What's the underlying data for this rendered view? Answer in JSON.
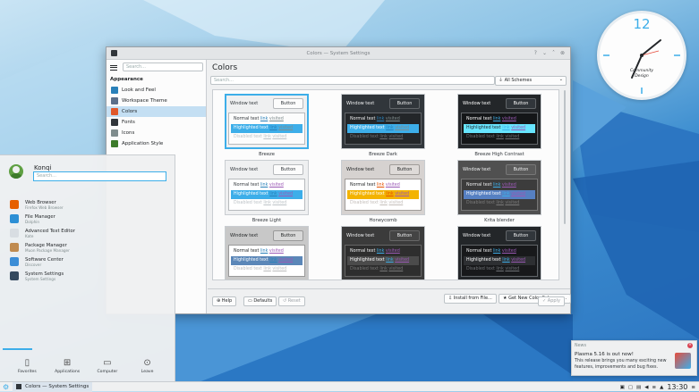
{
  "window": {
    "title": "Colors — System Settings",
    "help_btn": "?",
    "min_btn": "⌄",
    "max_btn": "˄",
    "close_btn": "⊗"
  },
  "sidebar": {
    "search_placeholder": "Search...",
    "section": "Appearance",
    "items": [
      {
        "label": "Look and Feel",
        "icon": "look-and-feel-icon",
        "color": "#2980b9"
      },
      {
        "label": "Workspace Theme",
        "icon": "workspace-theme-icon",
        "color": "#5b6f8a"
      },
      {
        "label": "Colors",
        "icon": "colors-icon",
        "color": "#e0582a"
      },
      {
        "label": "Fonts",
        "icon": "fonts-icon",
        "color": "#31363b"
      },
      {
        "label": "Icons",
        "icon": "icons-icon",
        "color": "#7f8c8d"
      },
      {
        "label": "Application Style",
        "icon": "app-style-icon",
        "color": "#3d7b2b"
      }
    ]
  },
  "main": {
    "title": "Colors",
    "search_placeholder": "Search...",
    "filter": "All Schemes"
  },
  "schemes": [
    {
      "name": "Breeze",
      "selected": true,
      "bg": "#eff0f1",
      "fg": "#31363b",
      "btn": "#fcfcfc",
      "btnborder": "#b7babd",
      "view": "#fcfcfc",
      "hl": "#3daee9",
      "hltext": "#ffffff",
      "link": "#2980b9",
      "visited": "#7f8c8d",
      "dis": "#bdc3c7"
    },
    {
      "name": "Breeze Dark",
      "bg": "#31363b",
      "fg": "#eff0f1",
      "btn": "#31363b",
      "btnborder": "#616569",
      "view": "#232629",
      "hl": "#3daee9",
      "hltext": "#ffffff",
      "link": "#2980b9",
      "visited": "#7f8c8d",
      "dis": "#6e7175"
    },
    {
      "name": "Breeze High Contrast",
      "bg": "#232629",
      "fg": "#fcfcfc",
      "btn": "#31363b",
      "btnborder": "#616569",
      "view": "#141618",
      "hl": "#67e5ff",
      "hltext": "#232629",
      "link": "#3daee9",
      "visited": "#9b59b6",
      "dis": "#6e7175"
    },
    {
      "name": "Breeze Light",
      "bg": "#eff0f1",
      "fg": "#31363b",
      "btn": "#fcfcfc",
      "btnborder": "#b7babd",
      "view": "#ffffff",
      "hl": "#3daee9",
      "hltext": "#ffffff",
      "link": "#2980b9",
      "visited": "#9b59b6",
      "dis": "#bdc3c7"
    },
    {
      "name": "Honeycomb",
      "bg": "#d6d2d0",
      "fg": "#232627",
      "btn": "#dedad8",
      "btnborder": "#a09c99",
      "view": "#ffffff",
      "hl": "#f3b300",
      "hltext": "#ffffff",
      "link": "#e65100",
      "visited": "#9b59b6",
      "dis": "#c4beba"
    },
    {
      "name": "Krita blender",
      "bg": "#505050",
      "fg": "#eff0f1",
      "btn": "#5a5a5a",
      "btnborder": "#777",
      "view": "#3c3c3c",
      "hl": "#5680c2",
      "hltext": "#ffffff",
      "link": "#3daee9",
      "visited": "#9b59b6",
      "dis": "#7a7a7a"
    },
    {
      "name": "",
      "bg": "#c8c8c8",
      "fg": "#232627",
      "btn": "#d8d8d8",
      "btnborder": "#999",
      "view": "#ffffff",
      "hl": "#5b87b8",
      "hltext": "#ffffff",
      "link": "#2980b9",
      "visited": "#9b59b6",
      "dis": "#bdbdbd"
    },
    {
      "name": "",
      "bg": "#3b3b3b",
      "fg": "#eff0f1",
      "btn": "#444",
      "btnborder": "#666",
      "view": "#2e2e2e",
      "hl": "#4b4b4b",
      "hltext": "#ffffff",
      "link": "#3daee9",
      "visited": "#9b59b6",
      "dis": "#777"
    },
    {
      "name": "",
      "bg": "#232629",
      "fg": "#eff0f1",
      "btn": "#31363b",
      "btnborder": "#616569",
      "view": "#18191b",
      "hl": "#2d2f32",
      "hltext": "#ffffff",
      "link": "#3daee9",
      "visited": "#9b59b6",
      "dis": "#6e7175"
    }
  ],
  "preview_text": {
    "window": "Window text",
    "button": "Button",
    "normal": "Normal text",
    "link": "link",
    "visited": "visited",
    "highlighted": "Highlighted text",
    "disabled": "Disabled text"
  },
  "actions": {
    "install": "Install from File...",
    "get_new": "Get New Color Schemes...",
    "help": "Help",
    "defaults": "Defaults",
    "reset": "Reset",
    "apply": "Apply"
  },
  "launcher": {
    "user": "Konqi",
    "search_placeholder": "Search...",
    "apps": [
      {
        "name": "Web Browser",
        "desc": "Firefox Web Browser",
        "icon": "firefox-icon",
        "color": "#e66000"
      },
      {
        "name": "File Manager",
        "desc": "Dolphin",
        "icon": "folder-icon",
        "color": "#2d8fd5"
      },
      {
        "name": "Advanced Text Editor",
        "desc": "Kate",
        "icon": "text-editor-icon",
        "color": "#d8dde2"
      },
      {
        "name": "Package Manager",
        "desc": "Muon Package Manager",
        "icon": "package-icon",
        "color": "#c08b50"
      },
      {
        "name": "Software Center",
        "desc": "Discover",
        "icon": "software-center-icon",
        "color": "#3c8dd6"
      },
      {
        "name": "System Settings",
        "desc": "System Settings",
        "icon": "settings-icon",
        "color": "#34495e"
      }
    ],
    "tabs": [
      "Favorites",
      "Applications",
      "Computer",
      "Leave"
    ]
  },
  "clock": {
    "numeral": "12",
    "brand1": "Community",
    "brand2": "Design"
  },
  "notification": {
    "app": "News",
    "title": "Plasma 5.16 is out now!",
    "body": "This release brings you many exciting new features, improvements and bug fixes."
  },
  "taskbar": {
    "task": "Colors — System Settings",
    "time": "13:30"
  }
}
